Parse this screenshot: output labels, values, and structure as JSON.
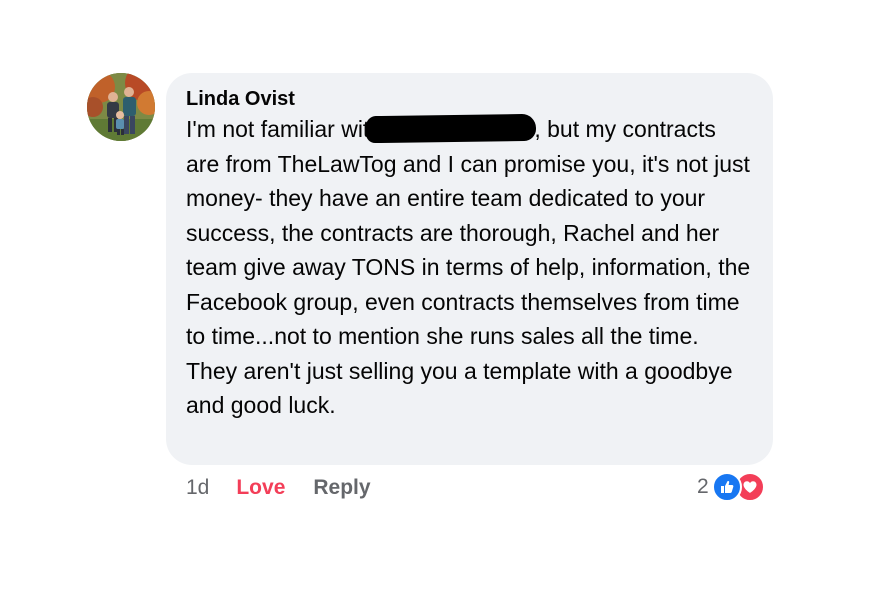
{
  "comment": {
    "author": "Linda Ovist",
    "text_before_redaction": "I'm not familiar wit",
    "text_after_redaction": ", but my contracts are from TheLawTog and I can promise you, it's not just money- they have an entire team dedicated to your success, the contracts are thorough, Rachel and her team give away TONS in terms of help, information, the Facebook group, even contracts themselves from time to time...not to mention she runs sales all the time. They aren't just selling you a template with a goodbye and good luck."
  },
  "actions": {
    "timestamp": "1d",
    "love_label": "Love",
    "reply_label": "Reply"
  },
  "reactions": {
    "count": "2",
    "icons": [
      "like-icon",
      "love-icon"
    ],
    "like_color": "#1877f2",
    "love_color": "#f33e58"
  },
  "colors": {
    "bubble_background": "#f0f2f5",
    "secondary_text": "#65676b"
  }
}
